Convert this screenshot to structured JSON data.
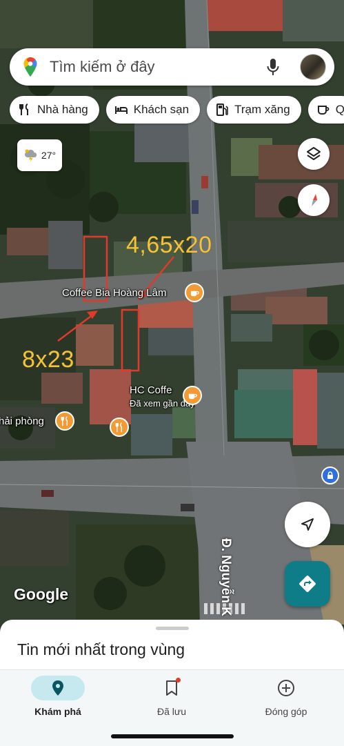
{
  "search": {
    "placeholder": "Tìm kiếm ở đây"
  },
  "chips": [
    {
      "label": "Nhà hàng",
      "icon": "restaurant-icon"
    },
    {
      "label": "Khách sạn",
      "icon": "hotel-icon"
    },
    {
      "label": "Trạm xăng",
      "icon": "gas-station-icon"
    },
    {
      "label": "Q",
      "icon": "coffee-icon"
    }
  ],
  "weather": {
    "temp": "27°",
    "icon": "thunderstorm-icon"
  },
  "map": {
    "pois": [
      {
        "name": "Coffee Bia Hoàng Lâm",
        "icon": "coffee-icon"
      },
      {
        "name": "HC Coffe",
        "sub": "Đã xem gần đây",
        "icon": "coffee-icon"
      },
      {
        "name": "hải phòng",
        "icon": "restaurant-icon"
      }
    ],
    "annotations": {
      "right_plot": "4,65x20",
      "left_plot": "8x23"
    },
    "annotation_color": "#f2c23c",
    "outline_color": "#e03a2a",
    "street": "Đ. Nguyễn K",
    "attribution": "Google"
  },
  "sheet": {
    "title": "Tin mới nhất trong vùng"
  },
  "nav": [
    {
      "label": "Khám phá",
      "icon": "explore-pin-icon",
      "active": true
    },
    {
      "label": "Đã lưu",
      "icon": "bookmark-icon",
      "active": false
    },
    {
      "label": "Đóng góp",
      "icon": "add-circle-icon",
      "active": false
    }
  ],
  "colors": {
    "accent": "#0f7d87",
    "poi_orange": "#f29b34",
    "nav_active_bg": "#c6e9ef"
  }
}
